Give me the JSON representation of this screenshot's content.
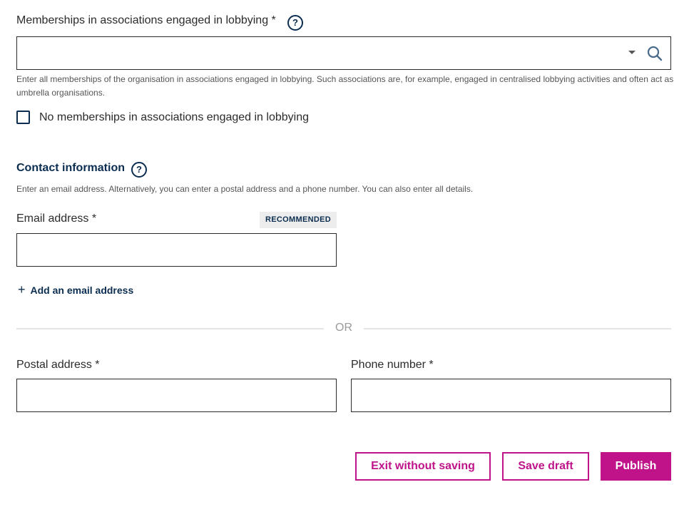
{
  "memberships": {
    "label": "Memberships in associations engaged in lobbying *",
    "help_glyph": "?",
    "input_value": "",
    "dropdown_icon": "caret-down-icon",
    "search_icon": "search-icon",
    "hint": "Enter all memberships of the organisation in associations engaged in lobbying. Such associations are, for example, engaged in centralised lobbying activities and often act as umbrella organisations.",
    "no_memberships_checkbox": {
      "label": "No memberships in associations engaged in lobbying",
      "checked": false
    }
  },
  "contact": {
    "title": "Contact information",
    "help_glyph": "?",
    "hint": "Enter an email address. Alternatively, you can enter a postal address and a phone number. You can also enter all details.",
    "email": {
      "label": "Email address *",
      "badge": "RECOMMENDED",
      "value": ""
    },
    "add_email": {
      "icon": "+",
      "label": "Add an email address"
    },
    "divider_text": "OR",
    "postal": {
      "label": "Postal address *",
      "value": ""
    },
    "phone": {
      "label": "Phone number *",
      "value": ""
    }
  },
  "actions": {
    "exit_label": "Exit without saving",
    "save_label": "Save draft",
    "publish_label": "Publish"
  },
  "colors": {
    "primary": "#c0138a",
    "navy": "#0b2d50"
  }
}
